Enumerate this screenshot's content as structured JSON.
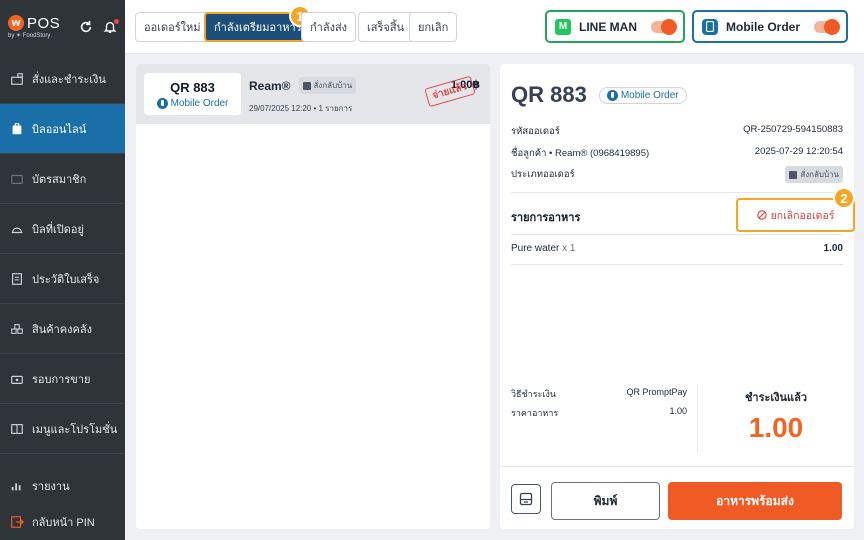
{
  "brand": {
    "logo_letter": "w",
    "name": "POS",
    "sub": "by ✶ FoodStory"
  },
  "sidebar": {
    "items": [
      {
        "label": "สั่งและชำระเงิน"
      },
      {
        "label": "บิลออนไลน์"
      },
      {
        "label": "บัตรสมาชิก"
      },
      {
        "label": "บิลที่เปิดอยู่"
      },
      {
        "label": "ประวัติใบเสร็จ"
      },
      {
        "label": "สินค้าคงคลัง"
      },
      {
        "label": "รอบการขาย"
      },
      {
        "label": "เมนูและโปรโมชั่น"
      }
    ],
    "bottom": [
      {
        "label": "รายงาน"
      },
      {
        "label": "กลับหน้า PIN"
      }
    ]
  },
  "tabs": [
    {
      "label": "ออเดอร์ใหม่"
    },
    {
      "label": "กำลังเตรียมอาหาร"
    },
    {
      "label": "กำลังส่ง"
    },
    {
      "label": "เสร็จสิ้น"
    },
    {
      "label": "ยกเลิก"
    }
  ],
  "callouts": {
    "one": "1",
    "two": "2"
  },
  "channels": {
    "lineman": {
      "icon": "M",
      "label": "LINE MAN"
    },
    "mobile": {
      "label": "Mobile Order"
    }
  },
  "order_list": [
    {
      "code": "QR 883",
      "channel": "Mobile Order",
      "name": "Ream®",
      "type": "สั่งกลับบ้าน",
      "meta": "29/07/2025 12:20 • 1 รายการ",
      "amount": "1.00฿",
      "stamp": "จ่ายแล้ว"
    }
  ],
  "detail": {
    "title": "QR 883",
    "channel": "Mobile Order",
    "order_id_label": "รหัสออเดอร์",
    "order_id": "QR-250729-594150883",
    "customer_label": "ชื่อลูกค้า • Ream® (0968419895)",
    "datetime": "2025-07-29 12:20:54",
    "type_label": "ประเภทออเดอร์",
    "type_value": "สั่งกลับบ้าน",
    "items_title": "รายการอาหาร",
    "cancel_label": "ยกเลิกออเดอร์",
    "items": [
      {
        "name": "Pure water",
        "qty": "x 1",
        "amount": "1.00"
      }
    ],
    "payment_method_label": "วิธีชำระเงิน",
    "payment_method": "QR PromptPay",
    "food_price_label": "ราคาอาหาร",
    "food_price": "1.00",
    "paid_label": "ชำระเงินแล้ว",
    "paid_amount": "1.00",
    "print_label": "พิมพ์",
    "ready_label": "อาหารพร้อมส่ง"
  },
  "colors": {
    "accent": "#f05a24",
    "primary": "#1b6fa8",
    "highlight": "#f5a623",
    "sidebar": "#2f3439"
  }
}
